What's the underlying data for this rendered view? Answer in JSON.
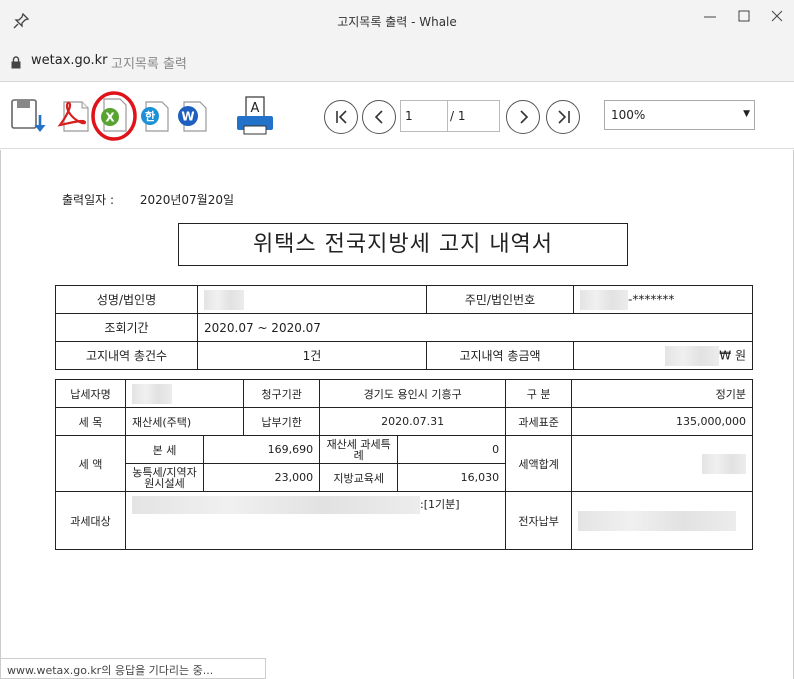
{
  "window": {
    "title": "고지목록 출력 - Whale",
    "icons": [
      "pin-icon",
      "minimize-icon",
      "maximize-icon",
      "close-icon"
    ]
  },
  "address": {
    "domain": "wetax.go.kr",
    "page_title": "고지목록 출력"
  },
  "toolbar": {
    "icons": [
      "save-icon",
      "pdf-icon",
      "excel-icon",
      "hwp-icon",
      "word-icon",
      "print-icon"
    ],
    "highlight_color": "#e0131a",
    "page_current": "1",
    "page_total": "/ 1",
    "zoom": "100%"
  },
  "document": {
    "print_date_label": "출력일자 :",
    "print_date": "2020년07월20일",
    "title": "위택스 전국지방세 고지 내역서",
    "summary": {
      "name_label": "성명/법인명",
      "id_label": "주민/법인번호",
      "id_value": "-*******",
      "period_label": "조회기간",
      "period_value": "2020.07 ~ 2020.07",
      "count_label": "고지내역 총건수",
      "count_value": "1건",
      "amount_label": "고지내역 총금액",
      "amount_value": "₩ 원"
    },
    "detail": {
      "taxpayer_label": "납세자명",
      "authority_label": "청구기관",
      "authority_value": "경기도 용인시 기흥구",
      "category_label": "구   분",
      "category_value": "정기분",
      "tax_item_label": "세   목",
      "tax_item_value": "재산세(주택)",
      "due_label": "납부기한",
      "due_value": "2020.07.31",
      "standard_label": "과세표준",
      "standard_value": "135,000,000",
      "amount_label": "세   액",
      "main_tax_label": "본 세",
      "main_tax_value": "169,690",
      "special_label": "재산세 과세특례",
      "special_value": "0",
      "extra_label": "농특세/지역자원시설세",
      "extra_value": "23,000",
      "edu_label": "지방교육세",
      "edu_value": "16,030",
      "total_label": "세액합계",
      "target_label": "과세대상",
      "target_suffix": ":[1기분]",
      "epay_label": "전자납부"
    }
  },
  "status": "www.wetax.go.kr의 응답을 기다리는 중..."
}
